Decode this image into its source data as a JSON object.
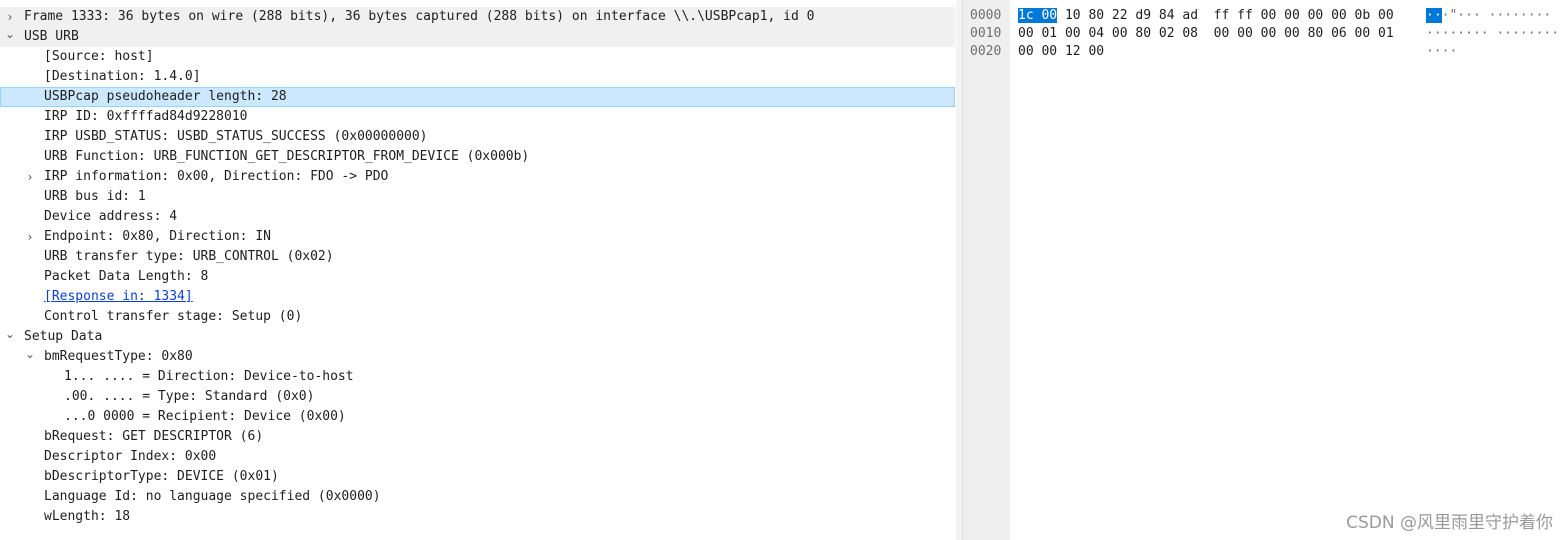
{
  "tree": [
    {
      "text": "Frame 1333: 36 bytes on wire (288 bits), 36 bytes captured (288 bits) on interface \\\\.\\USBPcap1, id 0",
      "depth": 0,
      "arrow": "collapsed",
      "style": "alt"
    },
    {
      "text": "USB URB",
      "depth": 0,
      "arrow": "expanded",
      "style": "alt"
    },
    {
      "text": "[Source: host]",
      "depth": 1,
      "arrow": "none",
      "style": ""
    },
    {
      "text": "[Destination: 1.4.0]",
      "depth": 1,
      "arrow": "none",
      "style": ""
    },
    {
      "text": "USBPcap pseudoheader length: 28",
      "depth": 1,
      "arrow": "none",
      "style": "sel"
    },
    {
      "text": "IRP ID: 0xffffad84d9228010",
      "depth": 1,
      "arrow": "none",
      "style": ""
    },
    {
      "text": "IRP USBD_STATUS: USBD_STATUS_SUCCESS (0x00000000)",
      "depth": 1,
      "arrow": "none",
      "style": ""
    },
    {
      "text": "URB Function: URB_FUNCTION_GET_DESCRIPTOR_FROM_DEVICE (0x000b)",
      "depth": 1,
      "arrow": "none",
      "style": ""
    },
    {
      "text": "IRP information: 0x00, Direction: FDO -> PDO",
      "depth": 1,
      "arrow": "collapsed",
      "style": ""
    },
    {
      "text": "URB bus id: 1",
      "depth": 1,
      "arrow": "none",
      "style": ""
    },
    {
      "text": "Device address: 4",
      "depth": 1,
      "arrow": "none",
      "style": ""
    },
    {
      "text": "Endpoint: 0x80, Direction: IN",
      "depth": 1,
      "arrow": "collapsed",
      "style": ""
    },
    {
      "text": "URB transfer type: URB_CONTROL (0x02)",
      "depth": 1,
      "arrow": "none",
      "style": ""
    },
    {
      "text": "Packet Data Length: 8",
      "depth": 1,
      "arrow": "none",
      "style": ""
    },
    {
      "text": "[Response in: 1334]",
      "depth": 1,
      "arrow": "none",
      "style": "link"
    },
    {
      "text": "Control transfer stage: Setup (0)",
      "depth": 1,
      "arrow": "none",
      "style": ""
    },
    {
      "text": "Setup Data",
      "depth": 0,
      "arrow": "expanded",
      "style": ""
    },
    {
      "text": "bmRequestType: 0x80",
      "depth": 1,
      "arrow": "expanded",
      "style": ""
    },
    {
      "text": "1... .... = Direction: Device-to-host",
      "depth": 2,
      "arrow": "none",
      "style": ""
    },
    {
      "text": ".00. .... = Type: Standard (0x0)",
      "depth": 2,
      "arrow": "none",
      "style": ""
    },
    {
      "text": "...0 0000 = Recipient: Device (0x00)",
      "depth": 2,
      "arrow": "none",
      "style": ""
    },
    {
      "text": "bRequest: GET DESCRIPTOR (6)",
      "depth": 1,
      "arrow": "none",
      "style": ""
    },
    {
      "text": "Descriptor Index: 0x00",
      "depth": 1,
      "arrow": "none",
      "style": ""
    },
    {
      "text": "bDescriptorType: DEVICE (0x01)",
      "depth": 1,
      "arrow": "none",
      "style": ""
    },
    {
      "text": "Language Id: no language specified (0x0000)",
      "depth": 1,
      "arrow": "none",
      "style": ""
    },
    {
      "text": "wLength: 18",
      "depth": 1,
      "arrow": "none",
      "style": ""
    }
  ],
  "hex": [
    {
      "offset": "0000",
      "hl_bytes": "1c 00",
      "bytes": " 10 80 22 d9 84 ad  ff ff 00 00 00 00 0b 00",
      "hl_ascii": "··",
      "ascii": "·\"··· ········"
    },
    {
      "offset": "0010",
      "hl_bytes": "",
      "bytes": "00 01 00 04 00 80 02 08  00 00 00 00 80 06 00 01",
      "hl_ascii": "",
      "ascii": "········ ········"
    },
    {
      "offset": "0020",
      "hl_bytes": "",
      "bytes": "00 00 12 00",
      "hl_ascii": "",
      "ascii": "····"
    }
  ],
  "watermark": "CSDN @风里雨里守护着你",
  "colors": {
    "selection": "#cce8ff",
    "byte_highlight": "#0078d7",
    "link": "#0b3fd6"
  }
}
